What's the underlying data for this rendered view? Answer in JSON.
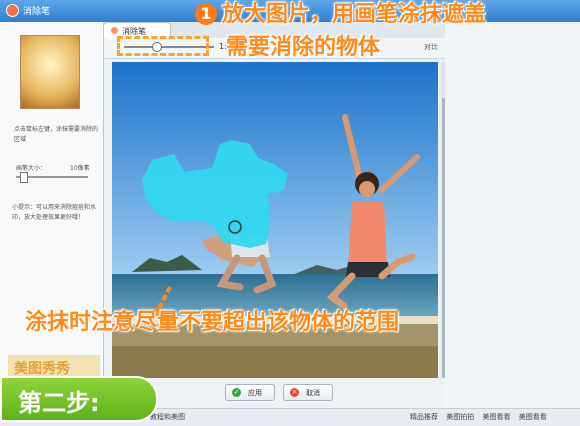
{
  "window": {
    "title": "消除笔"
  },
  "left_panel": {
    "hint": "点击鼠标左键，涂抹需要消除的区域",
    "brush_label": "画笔大小：",
    "brush_value": "10像素",
    "tip": "小提示：可以用来消除痘痘和水印，放大处理效果更好哦！",
    "logo_text": "美图秀秀"
  },
  "tab": {
    "label": "消除笔"
  },
  "toolbar": {
    "zoom_label": "1:",
    "right_label": "对比"
  },
  "actions": {
    "apply_label": "应用",
    "cancel_label": "取消"
  },
  "status": {
    "left": "教程和美图",
    "right_items": [
      "精品推荐",
      "美图拍拍",
      "美图看看",
      "美图看看"
    ]
  },
  "annotations": {
    "step_number": "1",
    "line1": "放大图片，用画笔涂抹遮盖",
    "line2": "需要消除的物体",
    "line3": "涂抹时注意尽量不要超出该物体的范围",
    "step2": "第二步:"
  },
  "colors": {
    "accent": "#ff8a1c",
    "paint": "#33d6f0",
    "step2_green": "#6cbf24"
  }
}
